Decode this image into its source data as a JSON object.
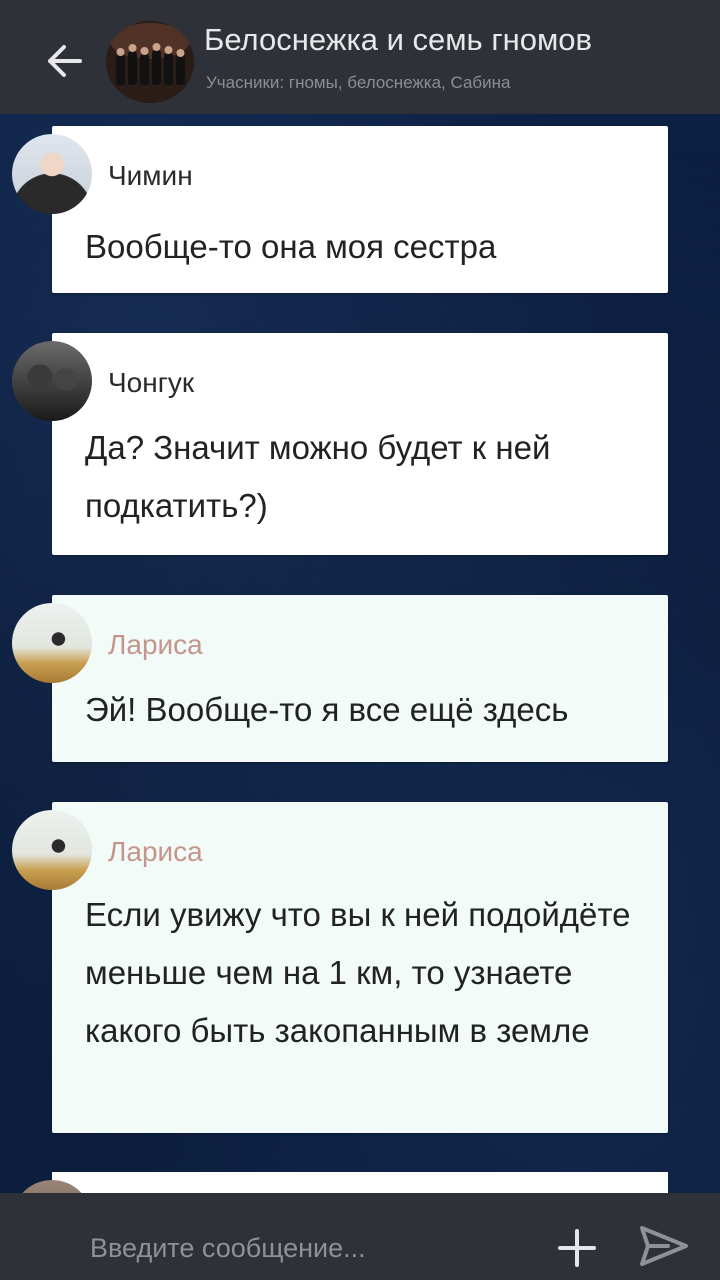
{
  "header": {
    "title": "Белоснежка и семь гномов",
    "subtitle": "Учасники: гномы, белоснежка, Сабина",
    "back_icon": "arrow-left-icon"
  },
  "messages": [
    {
      "author": "Чимин",
      "text": "Вообще-то она моя сестра",
      "author_color": "#2a2a2a"
    },
    {
      "author": "Чонгук",
      "text": "Да? Значит можно будет к ней подкатить?)",
      "author_color": "#2a2a2a"
    },
    {
      "author": "Лариса",
      "text": "Эй! Вообще-то я все ещё здесь",
      "author_color": "#c4958c"
    },
    {
      "author": "Лариса",
      "text": "Если увижу что вы к ней подойдёте меньше чем на 1 км, то узнаете какого быть закопанным в земле",
      "author_color": "#c4958c"
    }
  ],
  "composer": {
    "placeholder": "Введите сообщение...",
    "plus_icon": "plus-icon",
    "send_icon": "send-icon"
  },
  "colors": {
    "header_bg": "#2e3238",
    "chat_bg": "#0c1e3e",
    "bubble_white": "#ffffff",
    "bubble_mint": "#f2fbf8"
  }
}
